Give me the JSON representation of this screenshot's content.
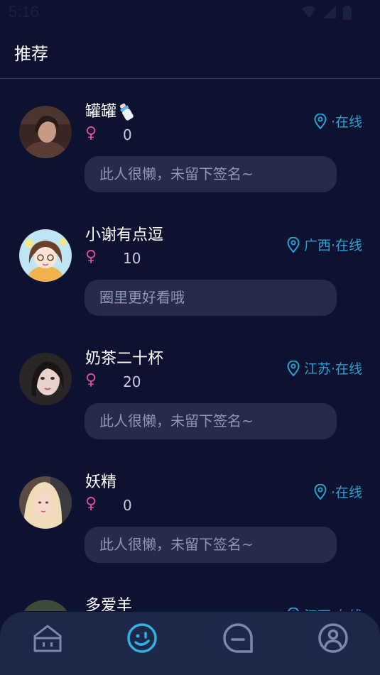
{
  "status_bar": {
    "time": "5:16"
  },
  "header": {
    "title": "推荐"
  },
  "users": [
    {
      "name": "罐罐",
      "gender_symbol": "♀",
      "count": "0",
      "location": "·在线",
      "signature": "此人很懒，未留下签名~"
    },
    {
      "name": "小谢有点逗",
      "gender_symbol": "♀",
      "count": "10",
      "location": "广西·在线",
      "signature": "圈里更好看哦"
    },
    {
      "name": "奶茶二十杯",
      "gender_symbol": "♀",
      "count": "20",
      "location": "江苏·在线",
      "signature": "此人很懒，未留下签名~"
    },
    {
      "name": "妖精",
      "gender_symbol": "♀",
      "count": "0",
      "location": "·在线",
      "signature": "此人很懒，未留下签名~"
    },
    {
      "name": "多爱羊",
      "gender_symbol": "",
      "count": "",
      "location": "江西·在线",
      "signature": ""
    }
  ],
  "bottom_nav": {
    "items": [
      {
        "icon": "home-icon"
      },
      {
        "icon": "discover-icon",
        "active": true
      },
      {
        "icon": "message-icon"
      },
      {
        "icon": "profile-icon"
      }
    ]
  },
  "colors": {
    "background": "#0c1230",
    "accent": "#2c9fd2",
    "gender_female": "#e0509a",
    "signature_bg": "#252b49",
    "nav_bg": "#1d2749"
  }
}
